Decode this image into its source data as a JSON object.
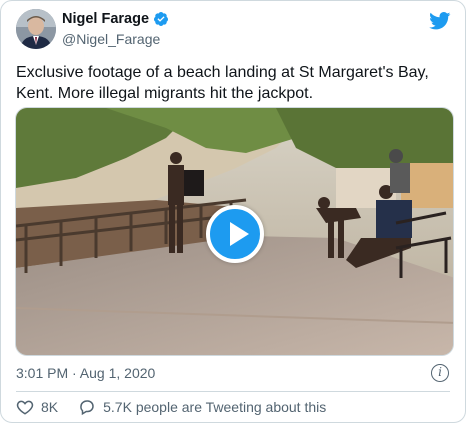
{
  "author": {
    "name": "Nigel Farage",
    "handle": "@Nigel_Farage",
    "verified_icon": "verified-badge-icon",
    "avatar_icon": "avatar"
  },
  "brand": {
    "logo_icon": "twitter-bird-icon",
    "accent": "#1d9bf0"
  },
  "tweet": {
    "text": "Exclusive footage of a beach landing at St Margaret's Bay, Kent. More illegal migrants hit the jackpot.",
    "media": {
      "type": "video",
      "play_icon": "play-icon"
    },
    "timestamp": "3:01 PM · Aug 1, 2020",
    "info_icon": "info-icon"
  },
  "engagement": {
    "likes": "8K",
    "like_icon": "heart-icon",
    "conversation_text": "5.7K people are Tweeting about this",
    "conversation_icon": "speech-bubble-icon"
  }
}
